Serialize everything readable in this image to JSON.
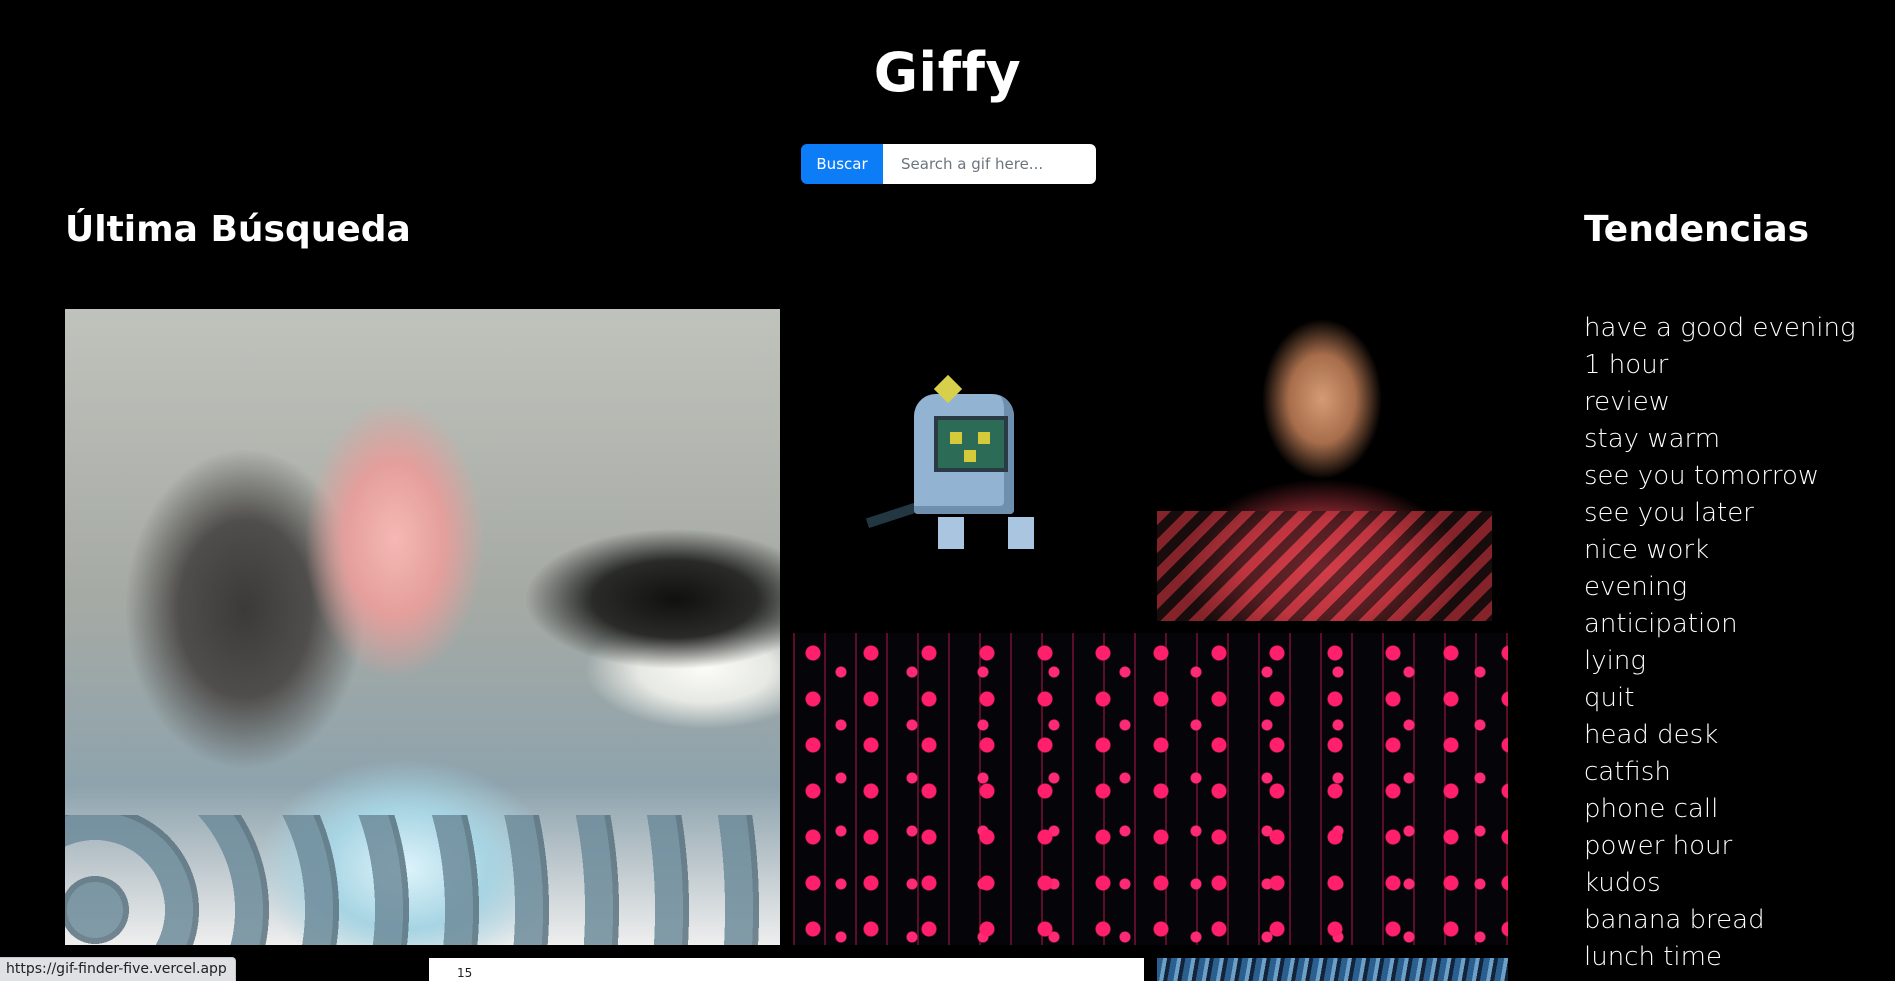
{
  "app": {
    "title": "Giffy"
  },
  "search": {
    "button_label": "Buscar",
    "placeholder": "Search a gif here...",
    "value": ""
  },
  "last_search": {
    "heading": "Última Búsqueda",
    "gif_count_visible": 6,
    "partial_gif_tick_label": "15"
  },
  "trends": {
    "heading": "Tendencias",
    "items": [
      "have a good evening",
      "1 hour",
      "review",
      "stay warm",
      "see you tomorrow",
      "see you later",
      "nice work",
      "evening",
      "anticipation",
      "lying",
      "quit",
      "head desk",
      "catfish",
      "phone call",
      "power hour",
      "kudos",
      "banana bread",
      "lunch time"
    ]
  },
  "status_bar": {
    "url": "https://gif-finder-five.vercel.app"
  },
  "colors": {
    "background": "#000000",
    "text": "#ffffff",
    "accent": "#0d7cf7"
  }
}
